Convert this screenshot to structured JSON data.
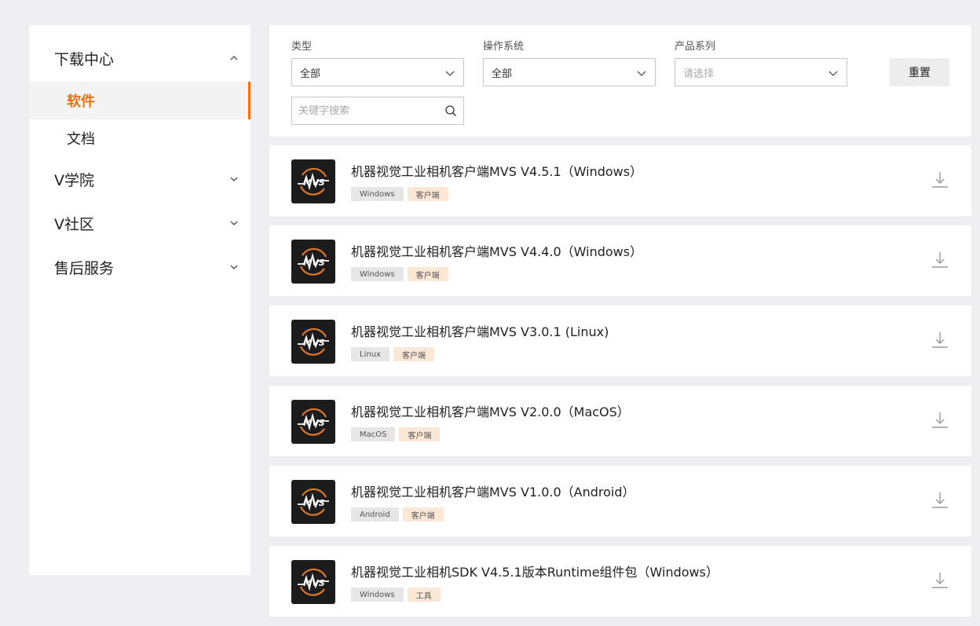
{
  "sidebar": {
    "sections": [
      {
        "label": "下载中心",
        "expanded": true
      },
      {
        "label": "V学院",
        "expanded": false
      },
      {
        "label": "V社区",
        "expanded": false
      },
      {
        "label": "售后服务",
        "expanded": false
      }
    ],
    "sub_items": [
      {
        "label": "软件",
        "active": true
      },
      {
        "label": "文档",
        "active": false
      }
    ]
  },
  "filters": {
    "type_label": "类型",
    "type_value": "全部",
    "os_label": "操作系统",
    "os_value": "全部",
    "series_label": "产品系列",
    "series_placeholder": "请选择",
    "reset_label": "重置",
    "search_placeholder": "关键字搜索"
  },
  "downloads": [
    {
      "title": "机器视觉工业相机客户端MVS V4.5.1（Windows）",
      "os": "Windows",
      "type": "客户端"
    },
    {
      "title": "机器视觉工业相机客户端MVS V4.4.0（Windows）",
      "os": "Windows",
      "type": "客户端"
    },
    {
      "title": "机器视觉工业相机客户端MVS V3.0.1 (Linux)",
      "os": "Linux",
      "type": "客户端"
    },
    {
      "title": "机器视觉工业相机客户端MVS V2.0.0（MacOS）",
      "os": "MacOS",
      "type": "客户端"
    },
    {
      "title": "机器视觉工业相机客户端MVS V1.0.0（Android）",
      "os": "Android",
      "type": "客户端"
    },
    {
      "title": "机器视觉工业相机SDK V4.5.1版本Runtime组件包（Windows）",
      "os": "Windows",
      "type": "工具"
    }
  ],
  "icons": {
    "logo": "mvs-logo-icon",
    "download": "download-icon",
    "search": "search-icon",
    "chevron": "chevron-icon"
  },
  "colors": {
    "accent": "#f26e0f",
    "background": "#eeeef0"
  }
}
